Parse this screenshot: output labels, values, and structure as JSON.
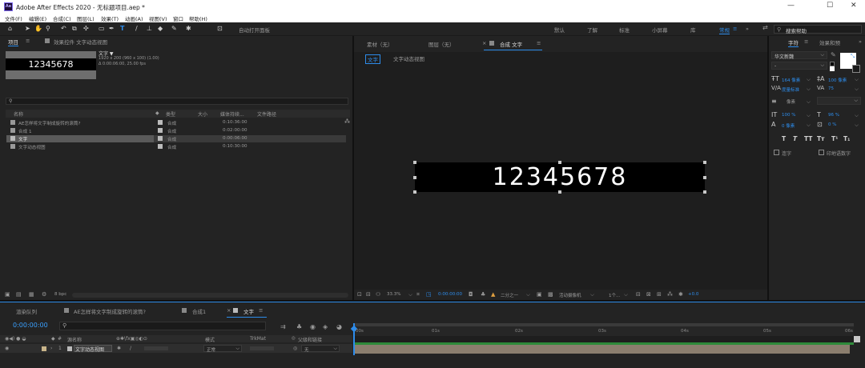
{
  "app": {
    "title": "Adobe After Effects 2020 - 无标题项目.aep *",
    "icon": "Ae"
  },
  "menu": [
    "文件(F)",
    "编辑(E)",
    "合成(C)",
    "图层(L)",
    "效果(T)",
    "动画(A)",
    "视图(V)",
    "窗口",
    "帮助(H)"
  ],
  "toolbar": {
    "auto_open": "自动打开面板",
    "workspaces": [
      "默认",
      "了解",
      "标准",
      "小屏幕",
      "库"
    ],
    "active_workspace": "常规",
    "search_placeholder": "搜索帮助"
  },
  "project_panel": {
    "tab": "项目",
    "effects_tab": "效果控件 文字动态视图",
    "preview_text": "12345678",
    "item_name": "文字 ▼",
    "item_info": [
      "1920 x 200 (960 x 100) (1.00)",
      "Δ 0:00:06:00, 25.00 fps"
    ],
    "search_placeholder": "",
    "columns": [
      "名称",
      "类型",
      "大小",
      "媒体持续...",
      "文件路径"
    ],
    "items": [
      {
        "name": "AE怎样将文字制成旋转的滚筒?",
        "type": "合成",
        "duration": "0:10:36:00"
      },
      {
        "name": "合成 1",
        "type": "合成",
        "duration": "0:02:00:00"
      },
      {
        "name": "文字",
        "type": "合成",
        "duration": "0:00:06:00"
      },
      {
        "name": "文字动态视图",
        "type": "合成",
        "duration": "0:10:30:00"
      }
    ],
    "bpc": "8 bpc"
  },
  "viewer": {
    "tabs": [
      "素材（无）",
      "图层（无）",
      "合成 文字"
    ],
    "subtabs": [
      "文字",
      "文字动态视图"
    ],
    "text": "12345678",
    "zoom": "33.3%",
    "time": "0:00:00:00",
    "resolution": "二分之一",
    "camera": "活动摄像机",
    "view": "1个...",
    "exposure": "+0.0"
  },
  "character": {
    "tab": "字符",
    "tab2": "效果和预",
    "font": "华文新魏",
    "style": "-",
    "size": "164 像素",
    "leading": "100 像素",
    "kerning": "度量标准",
    "tracking": "75",
    "stroke": "像素",
    "stroke_mode": "",
    "vscale": "100 %",
    "hscale": "96 %",
    "baseline": "0 像素",
    "tsume": "0 %",
    "styles": [
      "T",
      "T",
      "TT",
      "Tт",
      "T¹",
      "T₁"
    ],
    "ligatures": "连字",
    "hindi_digits": "印地语数字"
  },
  "timeline": {
    "tabs": [
      "渲染队列",
      "AE怎样将文字制成旋转的滚筒?",
      "合成1",
      "文字"
    ],
    "timecode": "0:00:00:00",
    "columns": [
      "源名称",
      "模式",
      "TrkMat",
      "父级和链接"
    ],
    "layer": {
      "index": "1",
      "name": "文字动态视图",
      "mode": "正常",
      "parent": "无"
    },
    "ticks": [
      "00s",
      "01s",
      "02s",
      "03s",
      "04s",
      "05s",
      "06s"
    ]
  },
  "colors": {
    "accent": "#2d8ceb",
    "bg": "#232323",
    "timecode": "#3aa0ff"
  }
}
